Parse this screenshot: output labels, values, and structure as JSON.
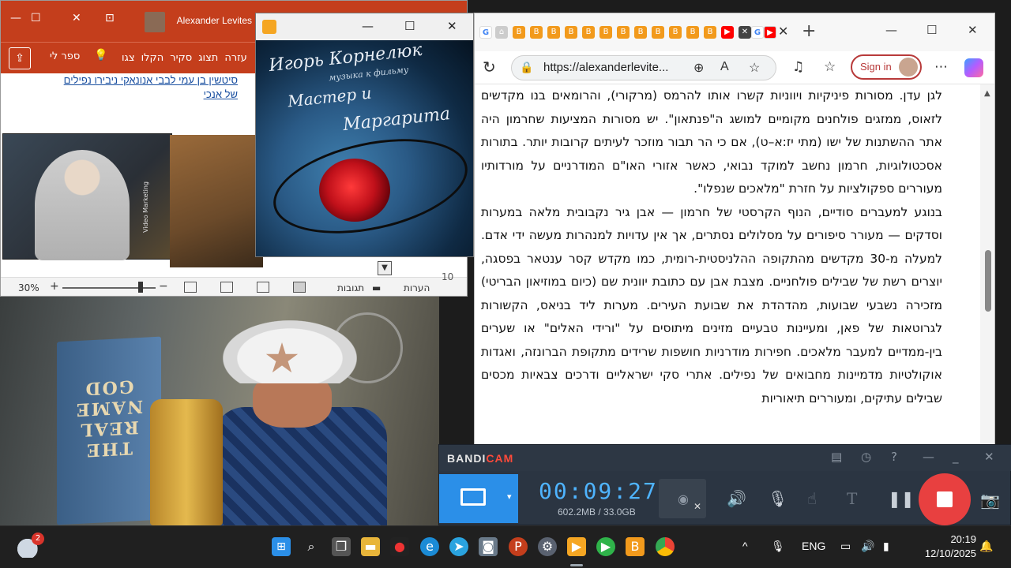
{
  "powerpoint": {
    "user_name": "Alexander Levites",
    "tabs": [
      "צגו",
      "הקלו",
      "סקיר",
      "תצוג",
      "עזרה"
    ],
    "tell_me": "ספר לי",
    "note_lines": [
      "סיטשין בן עמי לבבי אנונאקי ניבירו נפילים",
      "של אנכי"
    ],
    "thumb_caption": "Video Marketing",
    "zoom": "30%",
    "status_comments": "תגובות",
    "status_notes": "הערות",
    "page_fragment": "10"
  },
  "player": {
    "cover_title_1": "Игорь Корнелюк",
    "cover_subtitle": "музыка к фильму",
    "cover_title_2": "Мастер и",
    "cover_title_3": "Маргарита"
  },
  "browser": {
    "url": "https://alexanderlevite...",
    "sign_in": "Sign in",
    "article": [
      "לגן עדן. מסורות פיניקיות ויווניות קשרו אותו להרמס (מרקורי), והרומאים בנו מקדשים לזאוס, ממזגים פולחנים מקומיים למושג ה\"פנתאון\". יש מסורות המציעות שחרמון היה אתר ההשתנות של ישו (מתי יז:א–ט), אם כי הר תבור מוזכר לעיתים קרובות יותר. בתורות אסכטולוגיות, חרמון נחשב למוקד נבואי, כאשר אזורי האו\"ם המודרניים על מורדותיו מעוררים ספקולציות על חזרת \"מלאכים שנפלו\".",
      "בנוגע למעברים סודיים, הנוף הקרסטי של חרמון — אבן גיר נקבובית מלאה במערות וסדקים — מעורר סיפורים על מסלולים נסתרים, אך אין עדויות למנהרות מעשה ידי אדם. למעלה מ-30 מקדשים מהתקופה ההלניסטית-רומית, כמו מקדש קסר ענטאר בפסגה, יוצרים רשת של שבילים פולחניים. מצבת אבן עם כתובת יוונית שם (כיום במוזיאון הבריטי) מזכירה נשבעי שבועות, מהדהדת את שבועת העירים. מערות ליד בניאס, הקשורות לגרוטאות של פאן, ומעיינות טבעיים מזינים מיתוסים על \"ורידי האלים\" או שערים בין-ממדיים למעבר מלאכים. חפירות מודרניות חושפות שרידים מתקופת הברונזה, ואגדות אוקולטיות מדמיינות מחבואים של נפילים. אתרי סקי ישראליים ודרכים צבאיות מכסים שבילים עתיקים, ומעוררים תיאוריות"
    ]
  },
  "bandicam": {
    "brand": "BANDI",
    "brand_accent": "CAM",
    "timer": "00:09:27",
    "size": "602.2MB / 33.0GB"
  },
  "taskbar": {
    "weather_badge": "2",
    "language": "ENG",
    "time": "20:19",
    "date": "12/10/2025"
  }
}
